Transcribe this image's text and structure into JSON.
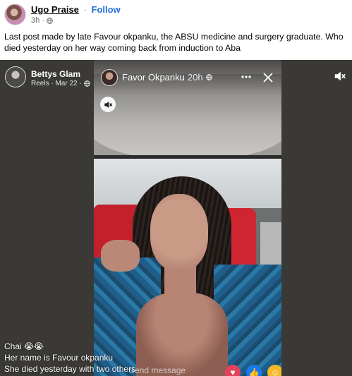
{
  "post": {
    "author": "Ugo Praise",
    "separator": "·",
    "follow_label": "Follow",
    "time": "3h",
    "time_separator": "·",
    "caption": "Last post made by late Favour okpanku, the ABSU medicine and surgery graduate. Who died yesterday on her way coming back from induction to Aba",
    "privacy_icon": "globe-icon"
  },
  "reel": {
    "author": "Bettys Glam",
    "meta": "Reels · Mar 22 ·",
    "privacy_icon": "globe-icon",
    "mute_icon": "speaker-muted-icon"
  },
  "story": {
    "name": "Favor Okpanku",
    "time": "20h",
    "privacy_icon": "globe-icon",
    "more_icon": "more-horizontal-icon",
    "close_icon": "close-icon",
    "sound_icon": "speaker-muted-icon",
    "send_message_placeholder": "Send message",
    "reactions": [
      "love-icon",
      "like-icon",
      "haha-icon"
    ]
  },
  "subtitles": {
    "line1": "Chai 😭😭",
    "line2": "Her name is Favour okpanku",
    "line3": "She died yesterday with two others"
  },
  "colors": {
    "follow": "#216fdb",
    "love": "#e4425a",
    "like": "#1877f2",
    "haha": "#f7b928"
  }
}
